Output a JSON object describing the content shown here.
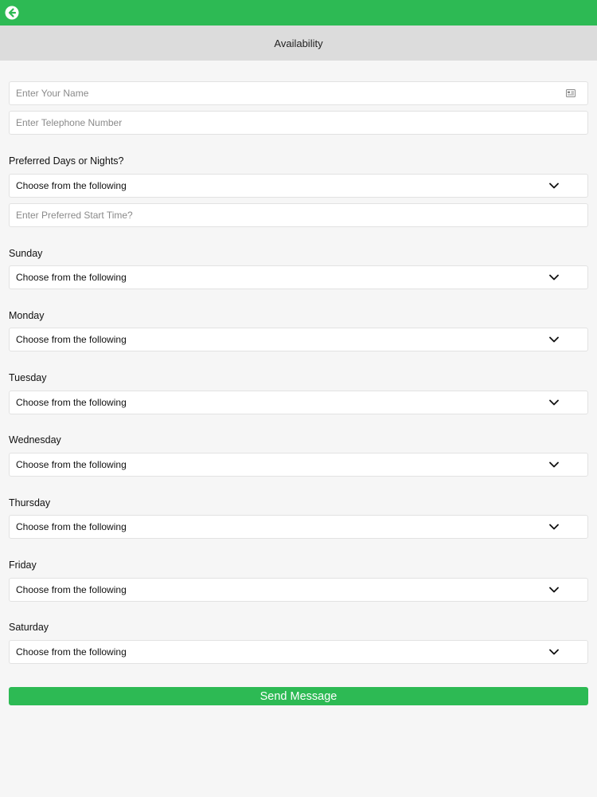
{
  "header": {
    "back_icon": "arrow-left-circle-icon",
    "title": "Availability",
    "accent_color": "#2dba54"
  },
  "form": {
    "name_placeholder": "Enter Your Name",
    "name_icon": "contact-card-icon",
    "phone_placeholder": "Enter Telephone Number",
    "preferred_label": "Preferred Days or Nights?",
    "preferred_value": "Choose from the following",
    "start_time_placeholder": "Enter Preferred Start Time?",
    "days": [
      {
        "label": "Sunday",
        "value": "Choose from the following"
      },
      {
        "label": "Monday",
        "value": "Choose from the following"
      },
      {
        "label": "Tuesday",
        "value": "Choose from the following"
      },
      {
        "label": "Wednesday",
        "value": "Choose from the following"
      },
      {
        "label": "Thursday",
        "value": "Choose from the following"
      },
      {
        "label": "Friday",
        "value": "Choose from the following"
      },
      {
        "label": "Saturday",
        "value": "Choose from the following"
      }
    ],
    "submit_label": "Send Message"
  }
}
